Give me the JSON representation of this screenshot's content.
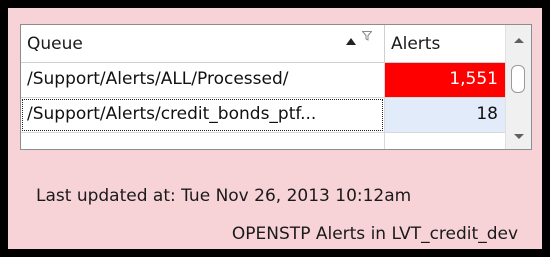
{
  "grid": {
    "columns": {
      "queue": "Queue",
      "alerts": "Alerts"
    },
    "rows": [
      {
        "queue": "/Support/Alerts/ALL/Processed/",
        "alerts": "1,551",
        "highlight": "#ff0000",
        "text_color": "#ffffff"
      },
      {
        "queue": "/Support/Alerts/credit_bonds_ptf...",
        "alerts": "18",
        "highlight": "#e1ebfa",
        "text_color": "#111111"
      }
    ],
    "sort": "ascending",
    "icons": {
      "sort": "sort-ascending-icon",
      "filter": "filter-icon",
      "scroll_up": "scroll-up-arrow-icon",
      "scroll_down": "scroll-down-arrow-icon"
    }
  },
  "footer": {
    "last_updated": "Last updated at: Tue Nov 26, 2013 10:12am",
    "source": "OPENSTP Alerts in LVT_credit_dev"
  },
  "colors": {
    "panel_background": "#f7d3d8",
    "outer_background": "#000000",
    "alert_high": "#ff0000",
    "alert_normal": "#e1ebfa"
  }
}
